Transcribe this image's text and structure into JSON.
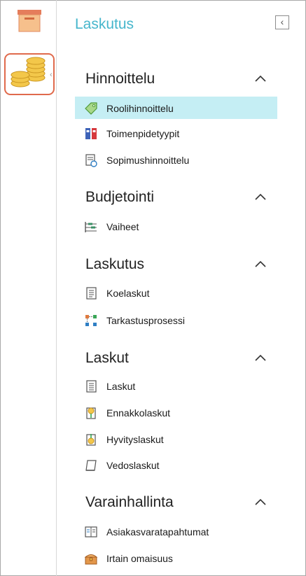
{
  "app": {
    "title": "Laskutus",
    "collapse_glyph": "‹"
  },
  "rail": {
    "items": [
      {
        "icon": "box-icon",
        "selected": false
      },
      {
        "icon": "coins-icon",
        "selected": true
      }
    ]
  },
  "groups": [
    {
      "title": "Hinnoittelu",
      "items": [
        {
          "label": "Roolihinnoittelu",
          "icon": "price-tag-icon",
          "selected": true
        },
        {
          "label": "Toimenpidetyypit",
          "icon": "binders-icon",
          "selected": false
        },
        {
          "label": "Sopimushinnoittelu",
          "icon": "contract-icon",
          "selected": false
        }
      ]
    },
    {
      "title": "Budjetointi",
      "items": [
        {
          "label": "Vaiheet",
          "icon": "phases-icon",
          "selected": false
        }
      ]
    },
    {
      "title": "Laskutus",
      "items": [
        {
          "label": "Koelaskut",
          "icon": "draft-invoice-icon",
          "selected": false
        },
        {
          "label": "Tarkastusprosessi",
          "icon": "process-icon",
          "selected": false
        }
      ]
    },
    {
      "title": "Laskut",
      "items": [
        {
          "label": "Laskut",
          "icon": "invoice-icon",
          "selected": false
        },
        {
          "label": "Ennakkolaskut",
          "icon": "advance-invoice-icon",
          "selected": false
        },
        {
          "label": "Hyvityslaskut",
          "icon": "credit-note-icon",
          "selected": false
        },
        {
          "label": "Vedoslaskut",
          "icon": "proof-invoice-icon",
          "selected": false
        }
      ]
    },
    {
      "title": "Varainhallinta",
      "items": [
        {
          "label": "Asiakasvaratapahtumat",
          "icon": "customer-assets-icon",
          "selected": false
        },
        {
          "label": "Irtain omaisuus",
          "icon": "chest-icon",
          "selected": false
        }
      ]
    }
  ],
  "colors": {
    "accent": "#46b6cc",
    "selected_bg": "#c5eef4",
    "rail_selected_border": "#e06a4c"
  }
}
